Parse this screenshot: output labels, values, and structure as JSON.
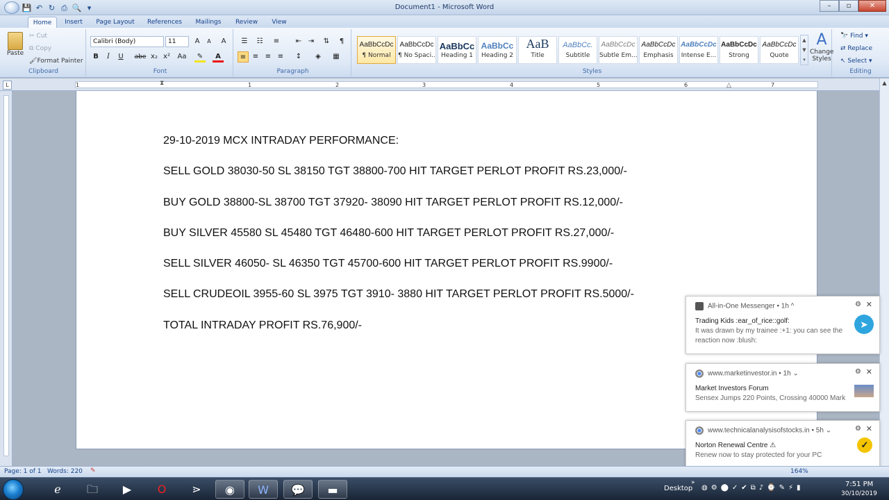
{
  "window": {
    "title": "Document1 - Microsoft Word",
    "qat_icons": [
      "save-icon",
      "undo-icon",
      "redo-icon",
      "print-icon",
      "print-preview-icon"
    ]
  },
  "tabs": [
    "Home",
    "Insert",
    "Page Layout",
    "References",
    "Mailings",
    "Review",
    "View"
  ],
  "ribbon": {
    "clipboard": {
      "paste": "Paste",
      "cut": "Cut",
      "copy": "Copy",
      "format_painter": "Format Painter",
      "label": "Clipboard"
    },
    "font": {
      "name": "Calibri (Body)",
      "size": "11",
      "label": "Font",
      "bold": "B",
      "italic": "I",
      "underline": "U",
      "strike": "abe",
      "subscript": "x₂",
      "superscript": "x²",
      "change_case": "Aa",
      "grow": "A",
      "shrink": "A",
      "clear": "A"
    },
    "paragraph": {
      "label": "Paragraph",
      "pilcrow": "¶"
    },
    "styles": {
      "label": "Styles",
      "items": [
        {
          "sample": "AaBbCcDc",
          "name": "¶ Normal"
        },
        {
          "sample": "AaBbCcDc",
          "name": "¶ No Spaci..."
        },
        {
          "sample": "AaBbCc",
          "name": "Heading 1"
        },
        {
          "sample": "AaBbCc",
          "name": "Heading 2"
        },
        {
          "sample": "AaB",
          "name": "Title"
        },
        {
          "sample": "AaBbCc.",
          "name": "Subtitle"
        },
        {
          "sample": "AaBbCcDc",
          "name": "Subtle Em..."
        },
        {
          "sample": "AaBbCcDc",
          "name": "Emphasis"
        },
        {
          "sample": "AaBbCcDc",
          "name": "Intense E..."
        },
        {
          "sample": "AaBbCcDc",
          "name": "Strong"
        },
        {
          "sample": "AaBbCcDc",
          "name": "Quote"
        }
      ],
      "change_styles": "Change Styles"
    },
    "editing": {
      "label": "Editing",
      "find": "Find",
      "replace": "Replace",
      "select": "Select"
    }
  },
  "ruler": {
    "numbers": [
      "1",
      "1",
      "2",
      "3",
      "4",
      "5",
      "6",
      "7"
    ]
  },
  "document": {
    "lines": [
      "29-10-2019 MCX INTRADAY PERFORMANCE:",
      "SELL GOLD 38030-50 SL 38150 TGT 38800-700 HIT TARGET PERLOT PROFIT RS.23,000/-",
      "BUY GOLD 38800-SL 38700 TGT 37920- 38090 HIT TARGET PERLOT PROFIT RS.12,000/-",
      "BUY SILVER 45580 SL 45480 TGT 46480-600 HIT TARGET PERLOT PROFIT RS.27,000/-",
      "SELL SILVER  46050- SL 46350 TGT 45700-600 HIT TARGET PERLOT PROFIT RS.9900/-",
      "SELL CRUDEOIL 3955-60 SL 3975 TGT 3910- 3880 HIT TARGET PERLOT PROFIT RS.5000/-",
      "TOTAL INTRADAY PROFIT RS.76,900/-"
    ]
  },
  "statusbar": {
    "page": "Page: 1 of 1",
    "words": "Words: 220",
    "zoom": "164%"
  },
  "notifications": [
    {
      "app": "All-in-One Messenger",
      "time": "1h",
      "title": "Trading Kids :ear_of_rice::golf:",
      "body1": "It was drawn by my trainee :+1: you can see the",
      "body2": "reaction now :blush:",
      "icon": "telegram-icon"
    },
    {
      "app": "www.marketinvestor.in",
      "time": "1h",
      "title": "Market Investors Forum",
      "body1": "Sensex Jumps 220 Points, Crossing 40000 Mark",
      "icon": "news-thumbnail"
    },
    {
      "app": "www.technicalanalysisofstocks.in",
      "time": "5h",
      "title": "Norton Renewal Centre ⚠",
      "body1": "Renew now to stay protected for your PC",
      "icon": "norton-icon"
    }
  ],
  "taskbar": {
    "apps": [
      "internet-explorer-icon",
      "file-explorer-icon",
      "media-player-icon",
      "opera-icon",
      "app-icon",
      "chrome-icon",
      "word-icon",
      "whatsapp-icon",
      "terminal-icon"
    ],
    "desktop": "Desktop",
    "time": "7:51 PM",
    "date": "30/10/2019"
  }
}
